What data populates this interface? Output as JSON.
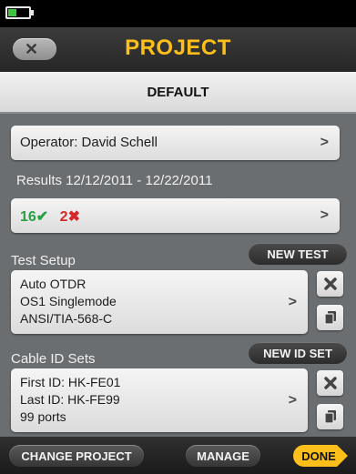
{
  "header": {
    "title": "PROJECT"
  },
  "project_name": "DEFAULT",
  "operator": {
    "label": "Operator: David Schell"
  },
  "results": {
    "label": "Results 12/12/2011 - 12/22/2011",
    "pass_count": "16",
    "pass_icon": "✔",
    "fail_count": "2",
    "fail_icon": "✖"
  },
  "test_setup": {
    "label": "Test Setup",
    "new_button": "NEW TEST",
    "lines": [
      "Auto OTDR",
      "OS1 Singlemode",
      "ANSI/TIA-568-C"
    ]
  },
  "cable_id_sets": {
    "label": "Cable ID Sets",
    "new_button": "NEW ID SET",
    "lines": [
      "First ID: HK-FE01",
      "Last ID: HK-FE99",
      "99 ports"
    ]
  },
  "footer": {
    "change_project": "CHANGE PROJECT",
    "manage": "MANAGE",
    "done": "DONE"
  },
  "colors": {
    "accent": "#ffbf1a",
    "pass": "#27a144",
    "fail": "#d6292a",
    "battery": "#3ec43e"
  }
}
